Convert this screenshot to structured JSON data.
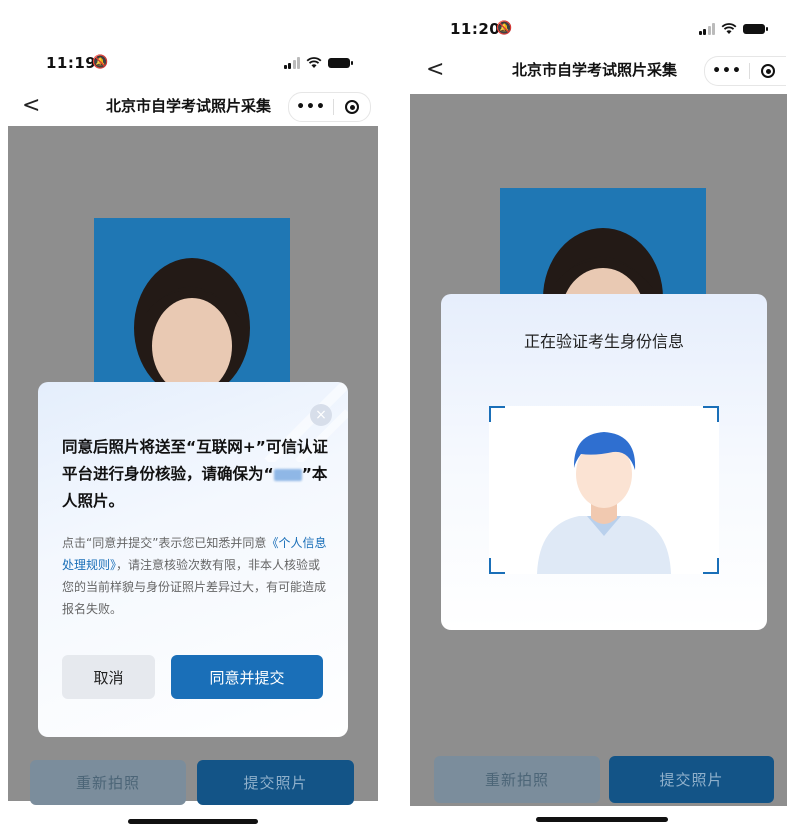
{
  "left_screen": {
    "status": {
      "time": "11:19"
    },
    "nav": {
      "back": "<",
      "title": "北京市自学考试照片采集",
      "more": "•••"
    },
    "dialog": {
      "close": "×",
      "heading_part1": "同意后照片将送至“互联网+”可信认证平台进行身份核验，请确保为“",
      "heading_part2": "”本人照片。",
      "desc_part1": "点击“同意并提交”表示您已知悉并同意",
      "desc_link": "《个人信息处理规则》",
      "desc_part2": "，请注意核验次数有限，非本人核验或您的当前样貌与身份证照片差异过大，有可能造成报名失败。",
      "cancel": "取消",
      "agree": "同意并提交"
    },
    "buttons": {
      "retake": "重新拍照",
      "submit": "提交照片"
    }
  },
  "right_screen": {
    "status": {
      "time": "11:20"
    },
    "nav": {
      "back": "<",
      "title": "北京市自学考试照片采集",
      "more": "•••"
    },
    "verify": {
      "title": "正在验证考生身份信息"
    },
    "buttons": {
      "retake": "重新拍照",
      "submit": "提交照片"
    }
  },
  "colors": {
    "accent": "#1a6fb8",
    "photo_bg": "#1f77b4",
    "overlay": "#8e8e8e",
    "submit_btn": "#135487"
  },
  "icons": [
    "silent-mode-icon",
    "signal-icon",
    "wifi-icon",
    "battery-icon",
    "back-icon",
    "more-icon",
    "target-icon",
    "close-icon",
    "avatar-placeholder-icon"
  ]
}
